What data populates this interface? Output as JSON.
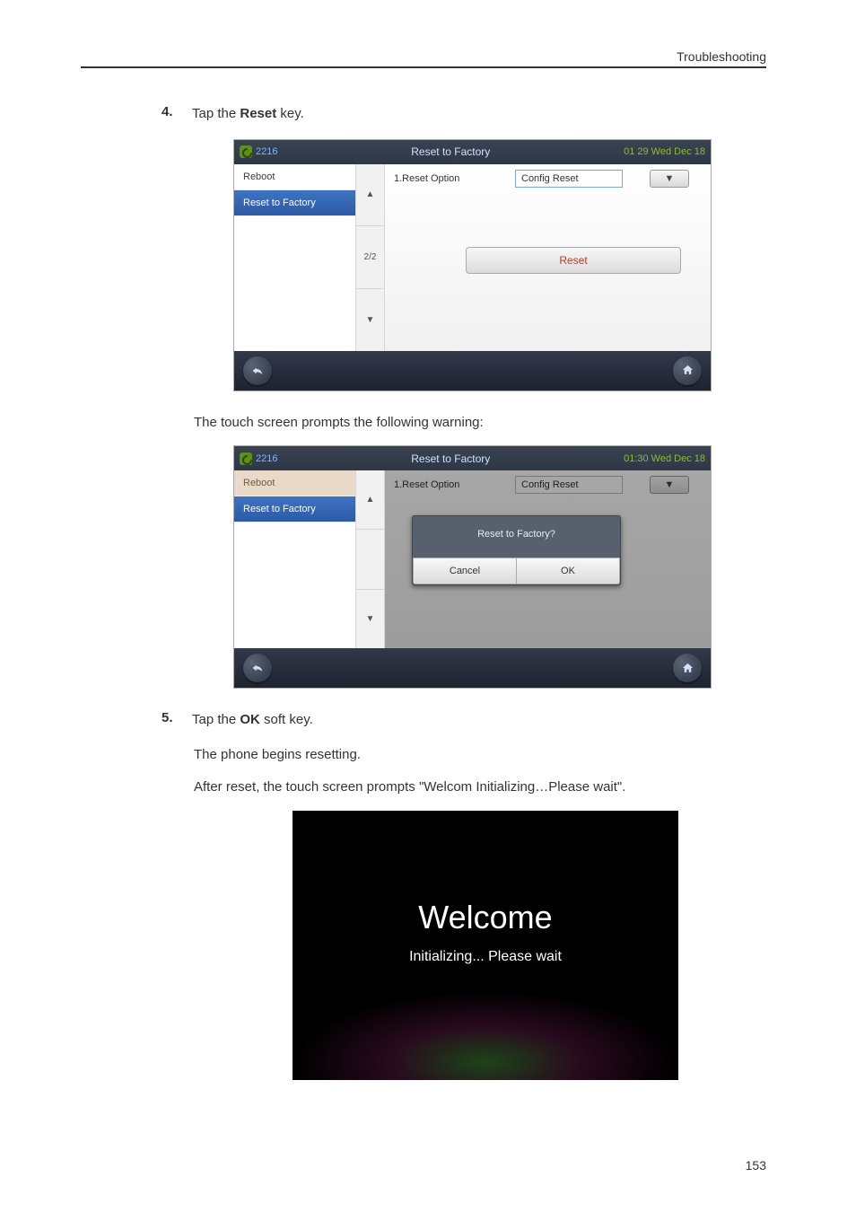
{
  "header": {
    "section": "Troubleshooting"
  },
  "steps": {
    "s4": {
      "num": "4.",
      "pre": "Tap the ",
      "bold": "Reset",
      "post": " key."
    },
    "s5": {
      "num": "5.",
      "pre": "Tap the ",
      "bold": "OK",
      "post": " soft key."
    }
  },
  "para": {
    "warning_intro": "The touch screen prompts the following warning:",
    "begin": "The phone begins resetting.",
    "after": "After reset, the touch screen prompts \"Welcom Initializing…Please wait\"."
  },
  "phone1": {
    "ext": "2216",
    "title": "Reset to Factory",
    "clock": "01 29 Wed Dec 18",
    "side": {
      "reboot": "Reboot",
      "reset": "Reset to Factory"
    },
    "scroll_mid": "2/2",
    "opt_label": "1.Reset Option",
    "opt_value": "Config Reset",
    "reset_btn": "Reset"
  },
  "phone2": {
    "ext": "2216",
    "title": "Reset to Factory",
    "clock": "01:30 Wed Dec 18",
    "side": {
      "reboot": "Reboot",
      "reset": "Reset to Factory"
    },
    "opt_label": "1.Reset Option",
    "opt_value": "Config Reset",
    "modal": {
      "title": "Reset to Factory?",
      "cancel": "Cancel",
      "ok": "OK"
    }
  },
  "welcome": {
    "big": "Welcome",
    "sub": "Initializing... Please wait"
  },
  "page_number": "153"
}
